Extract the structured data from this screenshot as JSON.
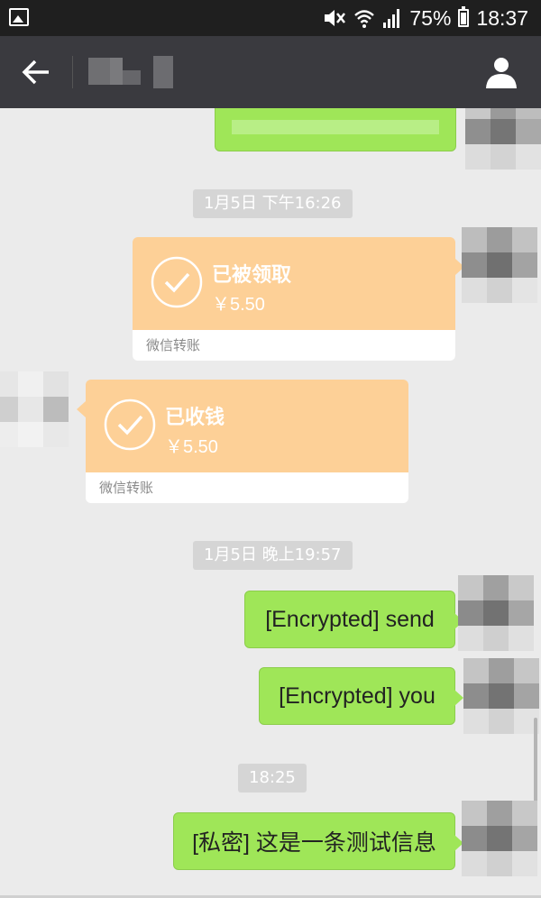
{
  "status_bar": {
    "battery_percent": "75%",
    "time": "18:37",
    "icons": [
      "gallery-icon",
      "mute-icon",
      "wifi-icon",
      "signal-icon",
      "battery-icon"
    ]
  },
  "title_bar": {
    "contact_name": "",
    "icons": [
      "back-arrow-icon",
      "profile-icon"
    ]
  },
  "messages": [
    {
      "type": "timestamp",
      "text": "1月5日 下午16:26"
    },
    {
      "type": "transfer",
      "direction": "outgoing",
      "status": "已被领取",
      "amount": "￥5.50",
      "label": "微信转账"
    },
    {
      "type": "transfer",
      "direction": "incoming",
      "status": "已收钱",
      "amount": "￥5.50",
      "label": "微信转账"
    },
    {
      "type": "timestamp",
      "text": "1月5日 晚上19:57"
    },
    {
      "type": "text",
      "direction": "outgoing",
      "text": "[Encrypted] send"
    },
    {
      "type": "text",
      "direction": "outgoing",
      "text": "[Encrypted] you"
    },
    {
      "type": "timestamp",
      "text": "18:25"
    },
    {
      "type": "text",
      "direction": "outgoing",
      "text": "[私密] 这是一条测试信息"
    }
  ],
  "colors": {
    "status_bar": "#1f1f1f",
    "title_bar": "#3a3a3f",
    "chat_bg": "#ebebeb",
    "green_bubble": "#9fe658",
    "transfer_orange": "#fdd097",
    "timestamp_bg": "#d5d5d5"
  }
}
